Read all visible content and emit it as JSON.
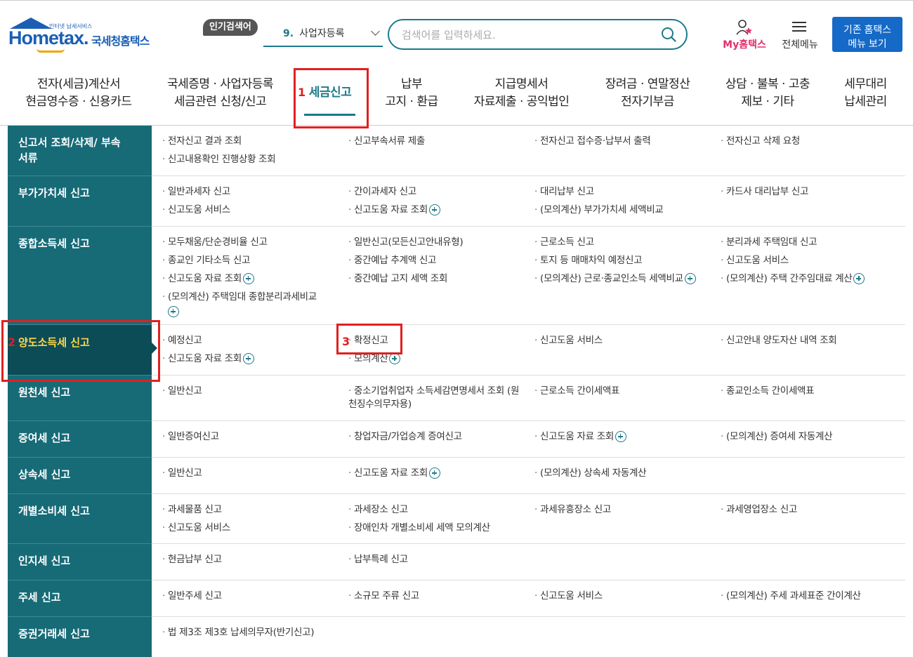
{
  "header": {
    "logo_tagline": "인터넷 납세서비스",
    "logo_main": "Hometax.",
    "logo_kr": "국세청홈택스",
    "popular_badge": "인기검색어",
    "popular_num": "9.",
    "popular_term": "사업자등록",
    "search_placeholder": "검색어를 입력하세요.",
    "my_prefix": "My",
    "my_suffix": "홈택스",
    "all_menu": "전체메뉴",
    "old_btn_l1": "기존 홈택스",
    "old_btn_l2": "메뉴 보기"
  },
  "gnb": [
    {
      "l1": "전자(세금)계산서",
      "l2": "현금영수증 · 신용카드"
    },
    {
      "l1": "국세증명 · 사업자등록",
      "l2": "세금관련 신청/신고"
    },
    {
      "l1": "세금신고",
      "l2": ""
    },
    {
      "l1": "납부",
      "l2": "고지 · 환급"
    },
    {
      "l1": "지급명세서",
      "l2": "자료제출 · 공익법인"
    },
    {
      "l1": "장려금 · 연말정산",
      "l2": "전자기부금"
    },
    {
      "l1": "상담 · 불복 · 고충",
      "l2": "제보 · 기타"
    },
    {
      "l1": "세무대리",
      "l2": "납세관리"
    }
  ],
  "annotations": [
    "1",
    "2",
    "3"
  ],
  "rows": [
    {
      "cat": "신고서 조회/삭제/ 부속서류",
      "items": [
        {
          "t": "전자신고 결과 조회"
        },
        {
          "t": "신고부속서류 제출"
        },
        {
          "t": "전자신고 접수증·납부서 출력"
        },
        {
          "t": "전자신고 삭제 요청"
        },
        {
          "t": "신고내용확인 진행상황 조회"
        }
      ]
    },
    {
      "cat": "부가가치세 신고",
      "items": [
        {
          "t": "일반과세자 신고"
        },
        {
          "t": "간이과세자 신고"
        },
        {
          "t": "대리납부 신고"
        },
        {
          "t": "카드사 대리납부 신고"
        },
        {
          "t": "신고도움 서비스"
        },
        {
          "t": "신고도움 자료 조회",
          "plus": true
        },
        {
          "t": "(모의계산) 부가가치세 세액비교"
        }
      ]
    },
    {
      "cat": "종합소득세 신고",
      "items": [
        {
          "t": "모두채움/단순경비율 신고"
        },
        {
          "t": "일반신고(모든신고안내유형)"
        },
        {
          "t": "근로소득 신고"
        },
        {
          "t": "분리과세 주택임대 신고"
        },
        {
          "t": "종교인 기타소득 신고"
        },
        {
          "t": "중간예납 추계액 신고"
        },
        {
          "t": "토지 등 매매차익 예정신고"
        },
        {
          "t": "신고도움 서비스"
        },
        {
          "t": "신고도움 자료 조회",
          "plus": true
        },
        {
          "t": "중간예납 고지 세액 조회"
        },
        {
          "t": "(모의계산) 근로·종교인소득 세액비교",
          "plus": true
        },
        {
          "t": "(모의계산) 주택 간주임대료 계산",
          "plus": true
        },
        {
          "t": "(모의계산) 주택임대 종합분리과세비교",
          "plus": true
        }
      ]
    },
    {
      "cat": "양도소득세 신고",
      "items": [
        {
          "t": "예정신고"
        },
        {
          "t": "확정신고"
        },
        {
          "t": "신고도움 서비스"
        },
        {
          "t": "신고안내 양도자산 내역 조회"
        },
        {
          "t": "신고도움 자료 조회",
          "plus": true
        },
        {
          "t": "모의계산",
          "plus": true
        }
      ]
    },
    {
      "cat": "원천세 신고",
      "items": [
        {
          "t": "일반신고"
        },
        {
          "t": "중소기업취업자 소득세감면명세서 조회 (원천징수의무자용)"
        },
        {
          "t": "근로소득 간이세액표"
        },
        {
          "t": "종교인소득 간이세액표"
        }
      ]
    },
    {
      "cat": "증여세 신고",
      "items": [
        {
          "t": "일반증여신고"
        },
        {
          "t": "창업자금/가업승계 증여신고"
        },
        {
          "t": "신고도움 자료 조회",
          "plus": true
        },
        {
          "t": "(모의계산) 증여세 자동계산"
        }
      ]
    },
    {
      "cat": "상속세 신고",
      "items": [
        {
          "t": "일반신고"
        },
        {
          "t": "신고도움 자료 조회",
          "plus": true
        },
        {
          "t": "(모의계산) 상속세 자동계산"
        }
      ]
    },
    {
      "cat": "개별소비세 신고",
      "items": [
        {
          "t": "과세물품 신고"
        },
        {
          "t": "과세장소 신고"
        },
        {
          "t": "과세유흥장소 신고"
        },
        {
          "t": "과세영업장소 신고"
        },
        {
          "t": "신고도움 서비스"
        },
        {
          "t": "장애인차 개별소비세 세액 모의계산"
        }
      ]
    },
    {
      "cat": "인지세 신고",
      "items": [
        {
          "t": "현금납부 신고"
        },
        {
          "t": "납부특례 신고"
        }
      ]
    },
    {
      "cat": "주세 신고",
      "items": [
        {
          "t": "일반주세 신고"
        },
        {
          "t": "소규모 주류 신고"
        },
        {
          "t": "신고도움 서비스"
        },
        {
          "t": "(모의계산) 주세 과세표준 간이계산"
        }
      ]
    },
    {
      "cat": "증권거래세 신고",
      "items": [
        {
          "t": "법 제3조 제3호 납세의무자(반기신고)"
        }
      ]
    }
  ]
}
